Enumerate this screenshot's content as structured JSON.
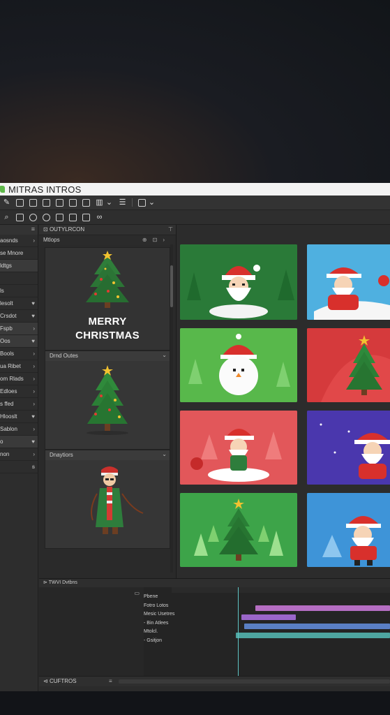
{
  "app": {
    "title": "MITRAS INTROS"
  },
  "left_panel": {
    "items": [
      {
        "label": "aosnds",
        "arrow": "›"
      },
      {
        "label": "se Mnore",
        "arrow": ""
      },
      {
        "label": "ldtgs",
        "arrow": ""
      },
      {
        "label": "",
        "arrow": ""
      },
      {
        "label": "ls",
        "arrow": ""
      },
      {
        "label": "lesolt",
        "arrow": "♥"
      },
      {
        "label": "Crsdot",
        "arrow": "♥"
      },
      {
        "label": "Fspb",
        "arrow": "›"
      },
      {
        "label": "Oos",
        "arrow": "♥"
      },
      {
        "label": "Bools",
        "arrow": "›"
      },
      {
        "label": "ua Ribet",
        "arrow": "›"
      },
      {
        "label": "om Rlads",
        "arrow": "›"
      },
      {
        "label": "Edloes",
        "arrow": "›"
      },
      {
        "label": "s ffed",
        "arrow": "›"
      },
      {
        "label": "Hlooslt",
        "arrow": "♥"
      },
      {
        "label": "Sablon",
        "arrow": "›"
      },
      {
        "label": "o",
        "arrow": "♥"
      },
      {
        "label": "non",
        "arrow": "›"
      },
      {
        "label": "",
        "arrow": "ꞩ"
      }
    ]
  },
  "library": {
    "header": "OUTYLRCON",
    "sub": "Mtlops",
    "cards": [
      {
        "label": "",
        "text1": "MERRY",
        "text2": "CHRISTMAS"
      },
      {
        "label": "Drnd Outes"
      },
      {
        "label": "Dnaytiors"
      }
    ]
  },
  "timeline": {
    "header": "TWVI Dvtbns",
    "tracks": [
      "Pbene",
      "Fotro Lotos",
      "Mesic Usetres",
      "- Bin Atlees",
      "Mtolcl.",
      "- Gsitjon"
    ]
  },
  "bottombar": {
    "label": "CUFTROS"
  },
  "colors": {
    "accent_green": "#5fb84a",
    "clip_pink": "#c677d2",
    "clip_blue": "#5a7fc4",
    "clip_teal": "#4ea5a0",
    "playhead": "#5fc4c4"
  }
}
